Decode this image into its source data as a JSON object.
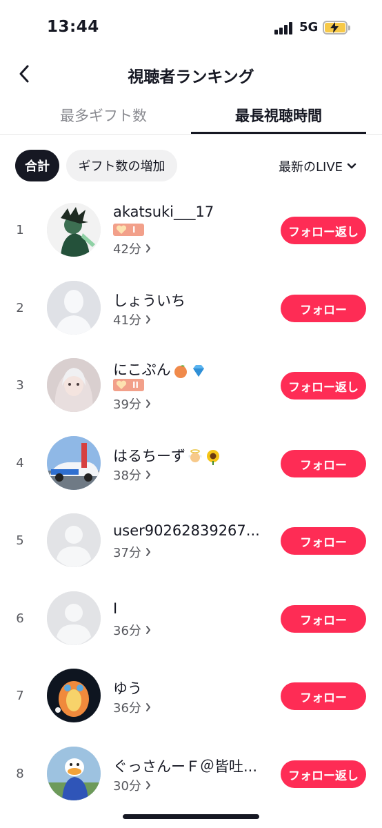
{
  "status_bar": {
    "time": "13:44",
    "network": "5G",
    "icons": [
      "signal-bars-icon",
      "battery-charging-icon"
    ]
  },
  "header": {
    "title": "視聴者ランキング",
    "back_icon": "chevron-left-icon"
  },
  "tabs": [
    {
      "label": "最多ギフト数",
      "active": false
    },
    {
      "label": "最長視聴時間",
      "active": true
    }
  ],
  "filters": {
    "chips": [
      {
        "label": "合計",
        "active": true
      },
      {
        "label": "ギフト数の増加",
        "active": false
      }
    ],
    "dropdown": {
      "label": "最新のLIVE",
      "icon": "chevron-down-icon"
    }
  },
  "ranking": [
    {
      "rank": "1",
      "name": "akatsuki___17",
      "badge": "I",
      "time": "42分",
      "button": "フォロー返し",
      "avatar": "photo-character"
    },
    {
      "rank": "2",
      "name": "しょういち",
      "badge": "",
      "time": "41分",
      "button": "フォロー",
      "avatar": "placeholder-silhouette"
    },
    {
      "rank": "3",
      "name": "にこぷん",
      "emojis": [
        "peach-emoji",
        "gem-emoji"
      ],
      "badge": "II",
      "time": "39分",
      "button": "フォロー返し",
      "avatar": "photo-person"
    },
    {
      "rank": "4",
      "name": "はるちーず",
      "emojis": [
        "baby-angel-emoji",
        "sunflower-emoji"
      ],
      "badge": "",
      "time": "38分",
      "button": "フォロー",
      "avatar": "photo-car"
    },
    {
      "rank": "5",
      "name": "user90262839267...",
      "badge": "",
      "time": "37分",
      "button": "フォロー",
      "avatar": "default-avatar"
    },
    {
      "rank": "6",
      "name": "I",
      "badge": "",
      "time": "36分",
      "button": "フォロー",
      "avatar": "default-avatar"
    },
    {
      "rank": "7",
      "name": "ゆう",
      "badge": "",
      "time": "36分",
      "button": "フォロー",
      "avatar": "photo-balloon"
    },
    {
      "rank": "8",
      "name": "ぐっさんーＦ＠皆吐...",
      "badge": "",
      "time": "30分",
      "button": "フォロー返し",
      "avatar": "photo-duck"
    }
  ],
  "colors": {
    "accent": "#fe2c55",
    "text": "#161823",
    "muted": "#8a8b91",
    "badge": "#f2a08a"
  }
}
